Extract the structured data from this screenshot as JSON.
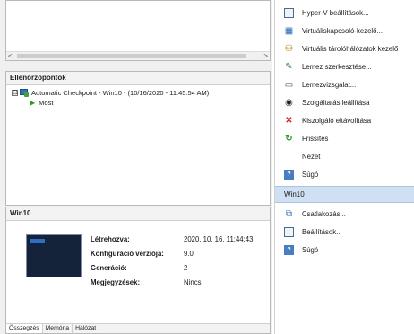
{
  "left": {
    "scroll_left_label": "<",
    "scroll_right_label": ">",
    "checkpoints": {
      "title": "Ellenőrzőpontok",
      "toggle": "⊟",
      "items": [
        {
          "label": "Automatic Checkpoint - Win10 - (10/16/2020 - 11:45:54 AM)"
        },
        {
          "label": "Most"
        }
      ]
    },
    "details": {
      "title": "Win10",
      "fields": [
        {
          "key": "Létrehozva:",
          "value": "2020. 10. 16. 11:44:43"
        },
        {
          "key": "Konfiguráció verziója:",
          "value": "9.0"
        },
        {
          "key": "Generáció:",
          "value": "2"
        },
        {
          "key": "Megjegyzések:",
          "value": "Nincs"
        }
      ],
      "tabs": [
        "Összegzés",
        "Memória",
        "Hálózat"
      ]
    }
  },
  "actions": {
    "top_items": [
      {
        "label": "Hyper-V beállítások...",
        "icon": "document-icon"
      },
      {
        "label": "Virtuáliskapcsoló-kezelő...",
        "icon": "switch-icon"
      },
      {
        "label": "Virtuális tárolóhálózatok kezelő",
        "icon": "san-icon"
      },
      {
        "label": "Lemez szerkesztése...",
        "icon": "edit-disk-icon"
      },
      {
        "label": "Lemezvizsgálat...",
        "icon": "inspect-disk-icon"
      },
      {
        "label": "Szolgáltatás leállítása",
        "icon": "stop-icon"
      },
      {
        "label": "Kiszolgáló eltávolítása",
        "icon": "remove-icon"
      },
      {
        "label": "Frissítés",
        "icon": "refresh-icon"
      },
      {
        "label": "Nézet",
        "icon": ""
      },
      {
        "label": "Súgó",
        "icon": "help-icon"
      }
    ],
    "section_title": "Win10",
    "vm_items": [
      {
        "label": "Csatlakozás...",
        "icon": "connect-icon"
      },
      {
        "label": "Beállítások...",
        "icon": "settings-icon"
      },
      {
        "label": "Súgó",
        "icon": "help-icon"
      }
    ]
  },
  "colors": {
    "section_bg": "#cfe0f2",
    "remove_red": "#d42020",
    "refresh_green": "#2a9a2a",
    "play_green": "#2a9a2a"
  }
}
